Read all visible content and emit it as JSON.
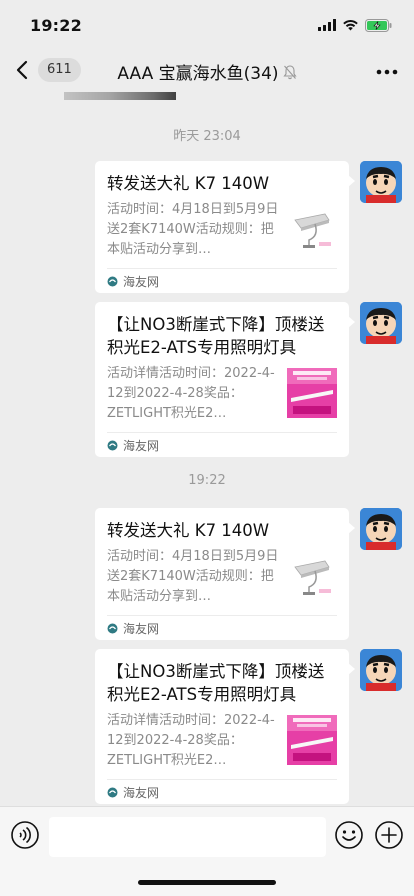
{
  "status": {
    "time": "19:22"
  },
  "nav": {
    "unread": "611",
    "title": "AAA 宝赢海水鱼(34)"
  },
  "messages": [
    {
      "timestamp": "昨天 23:04"
    },
    {
      "title": "转发送大礼 K7 140W",
      "desc": "活动时间：4月18日到5月9日送2套K7140W活动规则：把本贴活动分享到…",
      "source": "海友网",
      "thumb": "lamp"
    },
    {
      "title": "【让NO3断崖式下降】顶楼送积光E2-ATS专用照明灯具",
      "desc": "活动详情活动时间：2022-4-12到2022-4-28奖品：ZETLIGHT积光E2…",
      "source": "海友网",
      "thumb": "poster"
    },
    {
      "timestamp": "19:22"
    },
    {
      "title": "转发送大礼 K7 140W",
      "desc": "活动时间：4月18日到5月9日送2套K7140W活动规则：把本贴活动分享到…",
      "source": "海友网",
      "thumb": "lamp"
    },
    {
      "title": "【让NO3断崖式下降】顶楼送积光E2-ATS专用照明灯具",
      "desc": "活动详情活动时间：2022-4-12到2022-4-28奖品：ZETLIGHT积光E2…",
      "source": "海友网",
      "thumb": "poster"
    }
  ],
  "icons": {
    "back": "chevron-left-icon",
    "mute": "bell-off-icon",
    "more": "more-icon",
    "voice": "voice-icon",
    "emoji": "emoji-icon",
    "add": "plus-icon",
    "source": "source-icon"
  },
  "colors": {
    "background": "#ededed",
    "bubble": "#ffffff",
    "timestamp": "#9a9a9a",
    "battery": "#34c759"
  }
}
